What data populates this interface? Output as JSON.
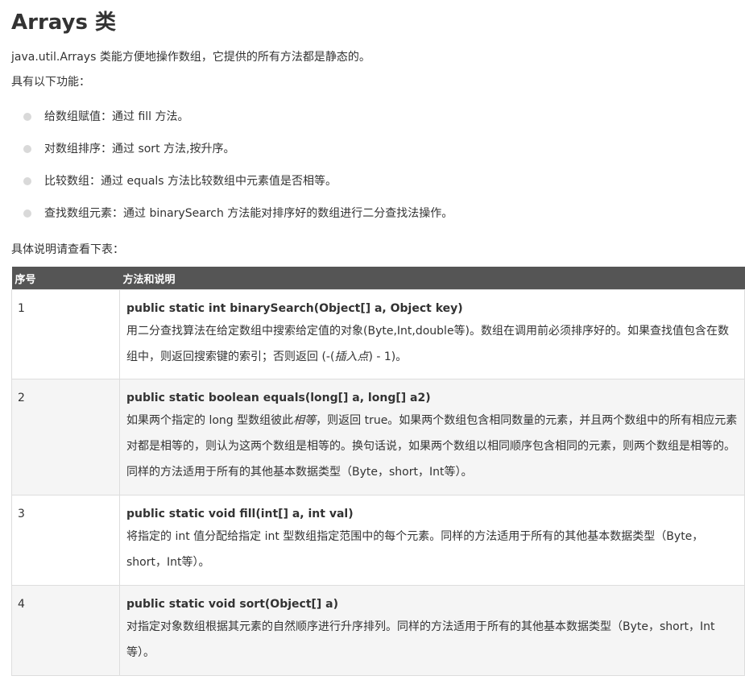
{
  "page": {
    "title": "Arrays 类",
    "intro_line1": "java.util.Arrays 类能方便地操作数组，它提供的所有方法都是静态的。",
    "intro_line2": "具有以下功能：",
    "table_intro": "具体说明请查看下表："
  },
  "features": [
    {
      "text": "给数组赋值：通过 fill 方法。"
    },
    {
      "text": "对数组排序：通过 sort 方法,按升序。"
    },
    {
      "text": "比较数组：通过 equals 方法比较数组中元素值是否相等。"
    },
    {
      "text": "查找数组元素：通过 binarySearch 方法能对排序好的数组进行二分查找法操作。"
    }
  ],
  "table": {
    "headers": {
      "num": "序号",
      "method": "方法和说明"
    },
    "rows": [
      {
        "num": "1",
        "signature": "public static int binarySearch(Object[] a, Object key)",
        "desc_a": "用二分查找算法在给定数组中搜索给定值的对象(Byte,Int,double等)。数组在调用前必须排序好的。如果查找值包含在数组中，则返回搜索键的索引；否则返回 (-(",
        "desc_em": "插入点",
        "desc_b": ") - 1)。"
      },
      {
        "num": "2",
        "signature": "public static boolean equals(long[] a, long[] a2)",
        "desc_a": "如果两个指定的 long 型数组彼此",
        "desc_em": "相等",
        "desc_b": "，则返回 true。如果两个数组包含相同数量的元素，并且两个数组中的所有相应元素对都是相等的，则认为这两个数组是相等的。换句话说，如果两个数组以相同顺序包含相同的元素，则两个数组是相等的。同样的方法适用于所有的其他基本数据类型（Byte，short，Int等）。"
      },
      {
        "num": "3",
        "signature": "public static void fill(int[] a, int val)",
        "desc_a": "将指定的 int 值分配给指定 int 型数组指定范围中的每个元素。同样的方法适用于所有的其他基本数据类型（Byte，short，Int等）。",
        "desc_em": "",
        "desc_b": ""
      },
      {
        "num": "4",
        "signature": "public static void sort(Object[] a)",
        "desc_a": "对指定对象数组根据其元素的自然顺序进行升序排列。同样的方法适用于所有的其他基本数据类型（Byte，short，Int等）。",
        "desc_em": "",
        "desc_b": ""
      }
    ]
  }
}
